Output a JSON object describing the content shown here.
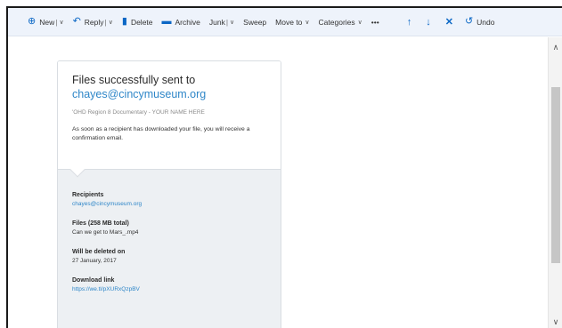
{
  "toolbar": {
    "new": {
      "label": "New",
      "icon": "plus-circle-icon"
    },
    "reply": {
      "label": "Reply",
      "icon": "reply-icon"
    },
    "delete": {
      "label": "Delete",
      "icon": "trash-icon"
    },
    "archive": {
      "label": "Archive",
      "icon": "archive-icon"
    },
    "junk": {
      "label": "Junk"
    },
    "sweep": {
      "label": "Sweep"
    },
    "move_to": {
      "label": "Move to"
    },
    "categories": {
      "label": "Categories"
    },
    "more": "•••",
    "undo": {
      "label": "Undo",
      "icon": "undo-icon"
    },
    "accent_color": "#0b67c5"
  },
  "email": {
    "title_line1": "Files successfully sent to",
    "title_email": "chayes@cincymuseum.org",
    "subject": "'OHD Region 8 Documentary - YOUR NAME HERE",
    "message": "As soon as a recipient has downloaded your file, you will receive a confirmation email.",
    "recipients_label": "Recipients",
    "recipients_value": "chayes@cincymuseum.org",
    "files_label": "Files (258 MB total)",
    "files_value": "Can we get to Mars_.mp4",
    "deleted_label": "Will be deleted on",
    "deleted_value": "27 January, 2017",
    "download_label": "Download link",
    "download_value": "https://we.tl/pXURxQzpBV",
    "link_color": "#2e86c8"
  }
}
